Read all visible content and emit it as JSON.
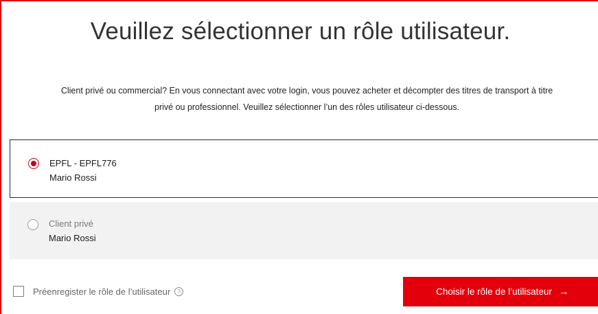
{
  "page": {
    "title": "Veuillez sélectionner un rôle utilisateur.",
    "intro_line1": "Client privé ou commercial? En vous connectant avec votre login, vous pouvez acheter et décompter des titres de transport à titre",
    "intro_line2": "privé ou professionnel. Veuillez sélectionner l’un des rôles utilisateur ci-dessous."
  },
  "roles": [
    {
      "title": "EPFL - EPFL776",
      "name": "Mario Rossi",
      "selected": true
    },
    {
      "title": "Client privé",
      "name": "Mario Rossi",
      "selected": false
    }
  ],
  "preregister": {
    "label": "Préenregister le rôle de l’utilisateur",
    "checked": false,
    "help_icon": "question-circle-icon",
    "help_glyph": "?"
  },
  "submit": {
    "label": "Choisir le rôle de l’utilisateur",
    "arrow": "→"
  },
  "colors": {
    "accent": "#e3000b",
    "radio_selected": "#c50018",
    "unselected_bg": "#f2f2f2"
  }
}
